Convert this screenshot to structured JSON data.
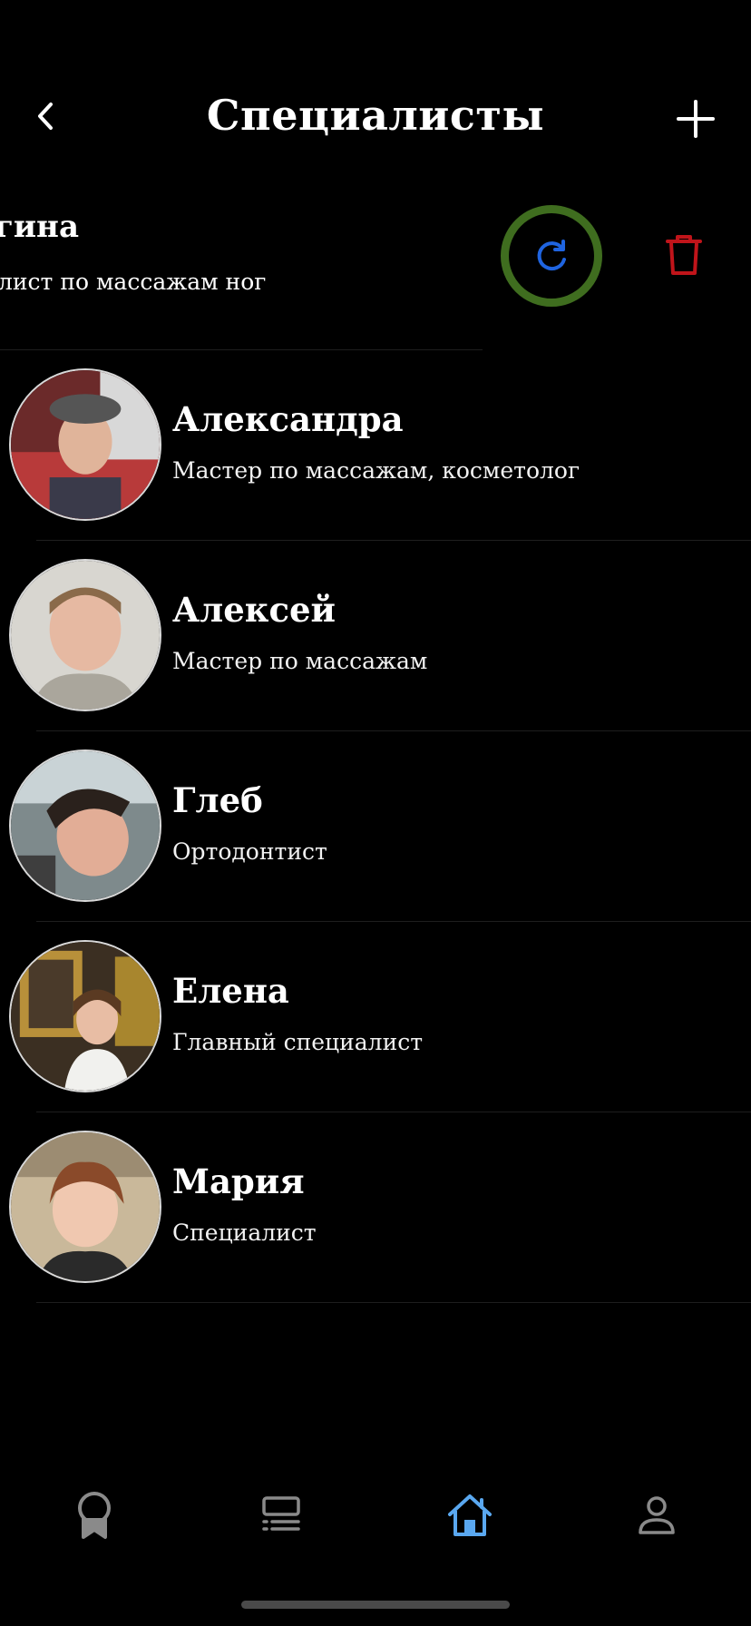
{
  "header": {
    "title": "Специалисты",
    "back_icon": "chevron-left-icon",
    "add_icon": "plus-icon"
  },
  "swiped_item": {
    "name": "гина",
    "description": "лист по массажам ног",
    "restore_icon": "refresh-icon",
    "delete_icon": "trash-icon",
    "colors": {
      "restore_ring": "#3f6d1f",
      "restore_icon": "#1f64e0",
      "delete_icon": "#c0141a"
    }
  },
  "specialists": [
    {
      "name": "Александра",
      "role": "Мастер по массажам, косметолог"
    },
    {
      "name": "Алексей",
      "role": "Мастер по массажам"
    },
    {
      "name": "Глеб",
      "role": "Ортодонтист"
    },
    {
      "name": "Елена",
      "role": "Главный специалист"
    },
    {
      "name": "Мария",
      "role": "Специалист"
    }
  ],
  "tabbar": {
    "tabs": [
      {
        "icon": "award-icon",
        "active": false
      },
      {
        "icon": "list-icon",
        "active": false
      },
      {
        "icon": "home-icon",
        "active": true
      },
      {
        "icon": "profile-icon",
        "active": false
      }
    ],
    "colors": {
      "active": "#5aa8f0",
      "inactive": "#8a8a8a"
    }
  }
}
